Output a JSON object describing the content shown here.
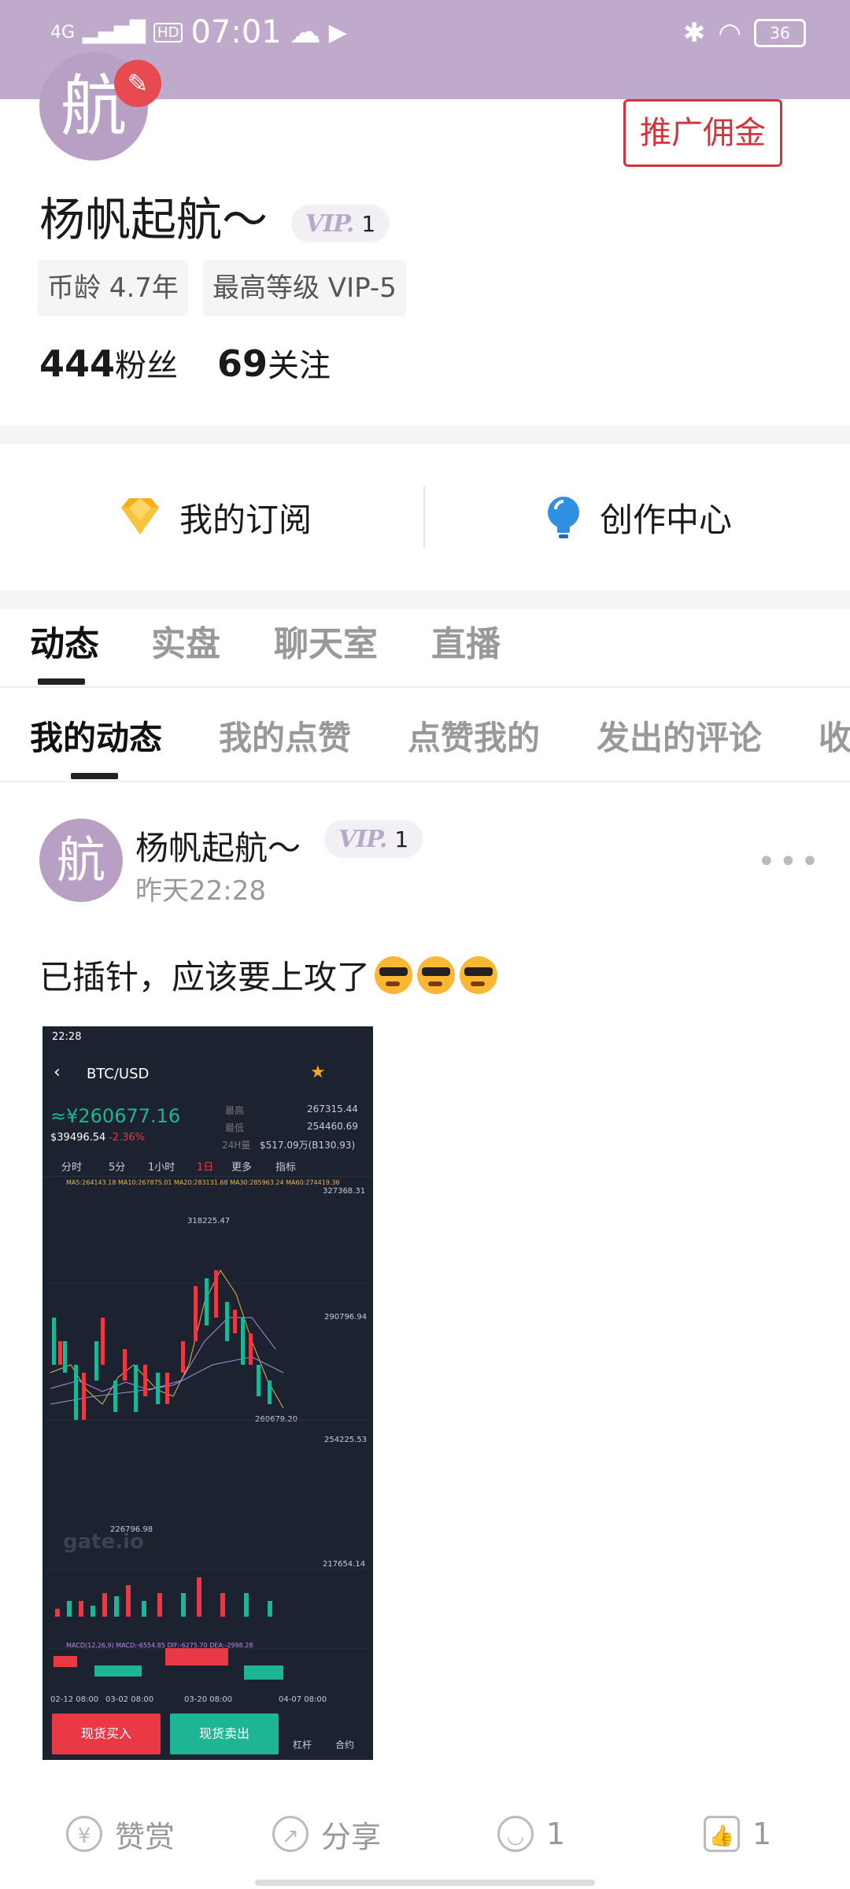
{
  "status_bar": {
    "time": "07:01",
    "signal": "4G",
    "hd": "HD",
    "battery": "36"
  },
  "profile": {
    "avatar_char": "航",
    "name": "杨帆起航～",
    "vip_mark": "VIP.",
    "vip_level": "1",
    "promo_button": "推广佣金",
    "tags": [
      "币龄 4.7年",
      "最高等级 VIP-5"
    ],
    "followers": "444",
    "followers_label": "粉丝",
    "following": "69",
    "following_label": "关注"
  },
  "quick_links": [
    {
      "label": "我的订阅",
      "icon": "diamond-icon"
    },
    {
      "label": "创作中心",
      "icon": "lightbulb-icon"
    }
  ],
  "main_tabs": [
    "动态",
    "实盘",
    "聊天室",
    "直播"
  ],
  "sub_tabs": [
    "我的动态",
    "我的点赞",
    "点赞我的",
    "发出的评论",
    "收"
  ],
  "post": {
    "avatar_char": "航",
    "author": "杨帆起航～",
    "vip_mark": "VIP.",
    "vip_level": "1",
    "time": "昨天22:28",
    "text": "已插针，应该要上攻了",
    "emojis": 3,
    "screenshot": {
      "status_time": "22:28",
      "pair": "BTC/USD",
      "price": "≈¥260677.16",
      "price_usd": "$39496.54",
      "change": "-2.36%",
      "high_label": "最高",
      "high": "267315.44",
      "low_label": "最低",
      "low": "254460.69",
      "vol_label": "24H量",
      "vol": "$517.09万(B130.93)",
      "intervals": [
        "分时",
        "5分",
        "1小时",
        "1日",
        "更多",
        "指标"
      ],
      "ma_line": "MA5:264143.18  MA10:267875.01  MA20:283131.68  MA30:285963.24  MA60:274419.36",
      "levels": [
        "327368.31",
        "318225.47",
        "290796.94",
        "260679.20",
        "254225.53",
        "226796.98",
        "217654.14"
      ],
      "watermark": "gate.io",
      "macd_line": "MACD(12,26,9)  MACD:-6554.85  DIF:-6275.70  DEA:-2998.28",
      "dates": [
        "02-12 08:00",
        "03-02 08:00",
        "03-20 08:00",
        "04-07 08:00"
      ],
      "buy": "现货买入",
      "sell": "现货卖出",
      "leverage": "杠杆",
      "contract": "合约"
    }
  },
  "actions": {
    "reward": "赞赏",
    "share": "分享",
    "comments": "1",
    "likes": "1"
  },
  "colors": {
    "status_bar": "#c0aacb",
    "accent_red": "#d0343d",
    "avatar": "#b8a0c4"
  }
}
